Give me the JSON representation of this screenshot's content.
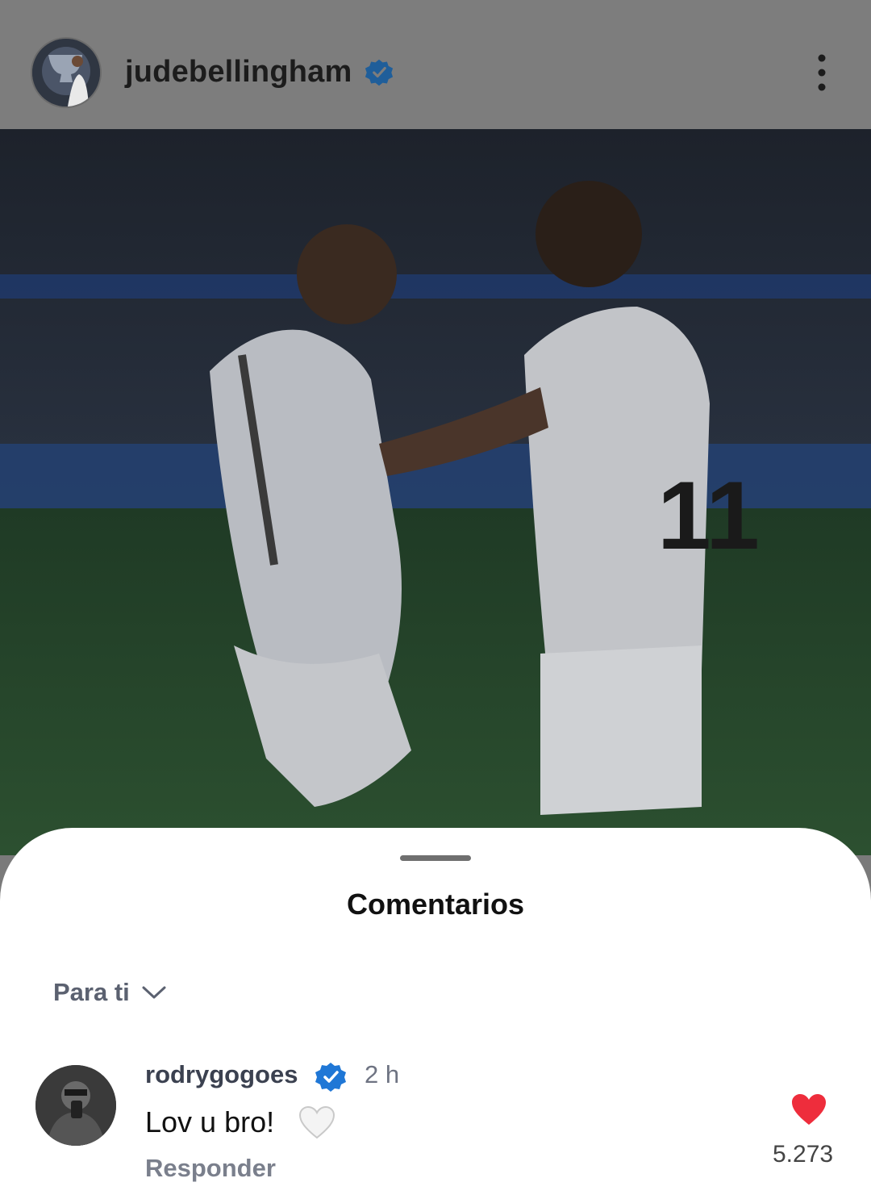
{
  "post": {
    "username": "judebellingham",
    "verified": true,
    "menu_icon": "more-vertical-icon"
  },
  "comments_sheet": {
    "title": "Comentarios",
    "filter_label": "Para ti",
    "filter_icon": "chevron-down-icon"
  },
  "comment": {
    "username": "rodrygogoes",
    "verified": true,
    "time": "2 h",
    "text": "Lov u bro!",
    "emoji": "white-heart",
    "reply_label": "Responder",
    "like_count": "5.273",
    "like_color": "#ee2d3c"
  },
  "colors": {
    "verified_badge": "#1f77d6",
    "sheet_background": "#ffffff"
  }
}
